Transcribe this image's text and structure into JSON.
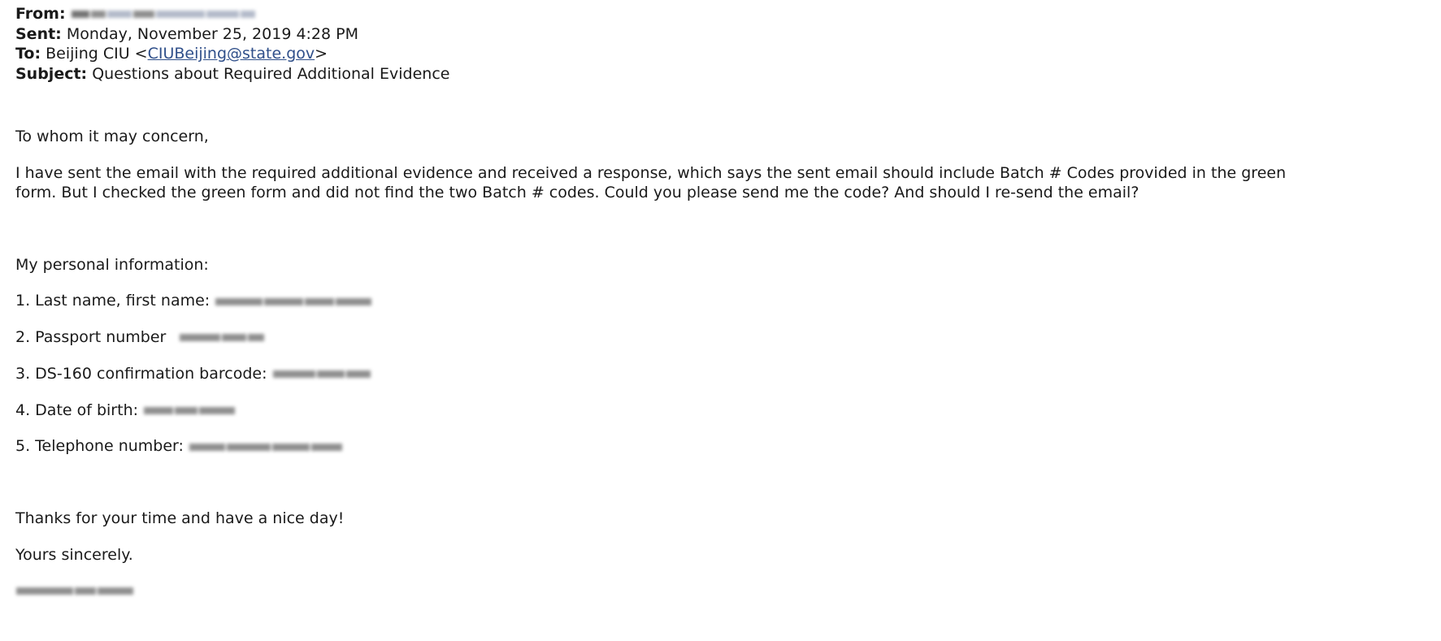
{
  "header": {
    "from_label": "From:",
    "sent_label": "Sent:",
    "sent_value": "Monday, November 25, 2019 4:28 PM",
    "to_label": "To:",
    "to_name": "Beijing CIU <",
    "to_email": "CIUBeijing@state.gov",
    "to_close": ">",
    "subject_label": "Subject:",
    "subject_value": "Questions about Required Additional Evidence"
  },
  "body": {
    "greeting": "To whom it may concern,",
    "paragraph": "I have sent the email with the required additional evidence and received a response, which says the sent email should include Batch # Codes provided in the green form. But I checked the green form and did not find the two Batch # codes. Could you please send me the code? And should I re-send the email?",
    "info_heading": "My personal information:",
    "items": [
      {
        "label": "1. Last name, first name:"
      },
      {
        "label": "2. Passport number"
      },
      {
        "label": "3. DS-160 confirmation barcode:"
      },
      {
        "label": "4. Date of birth:"
      },
      {
        "label": "5. Telephone number:"
      }
    ],
    "thanks": "Thanks for your time and have a nice day!",
    "closing": "Yours sincerely."
  }
}
